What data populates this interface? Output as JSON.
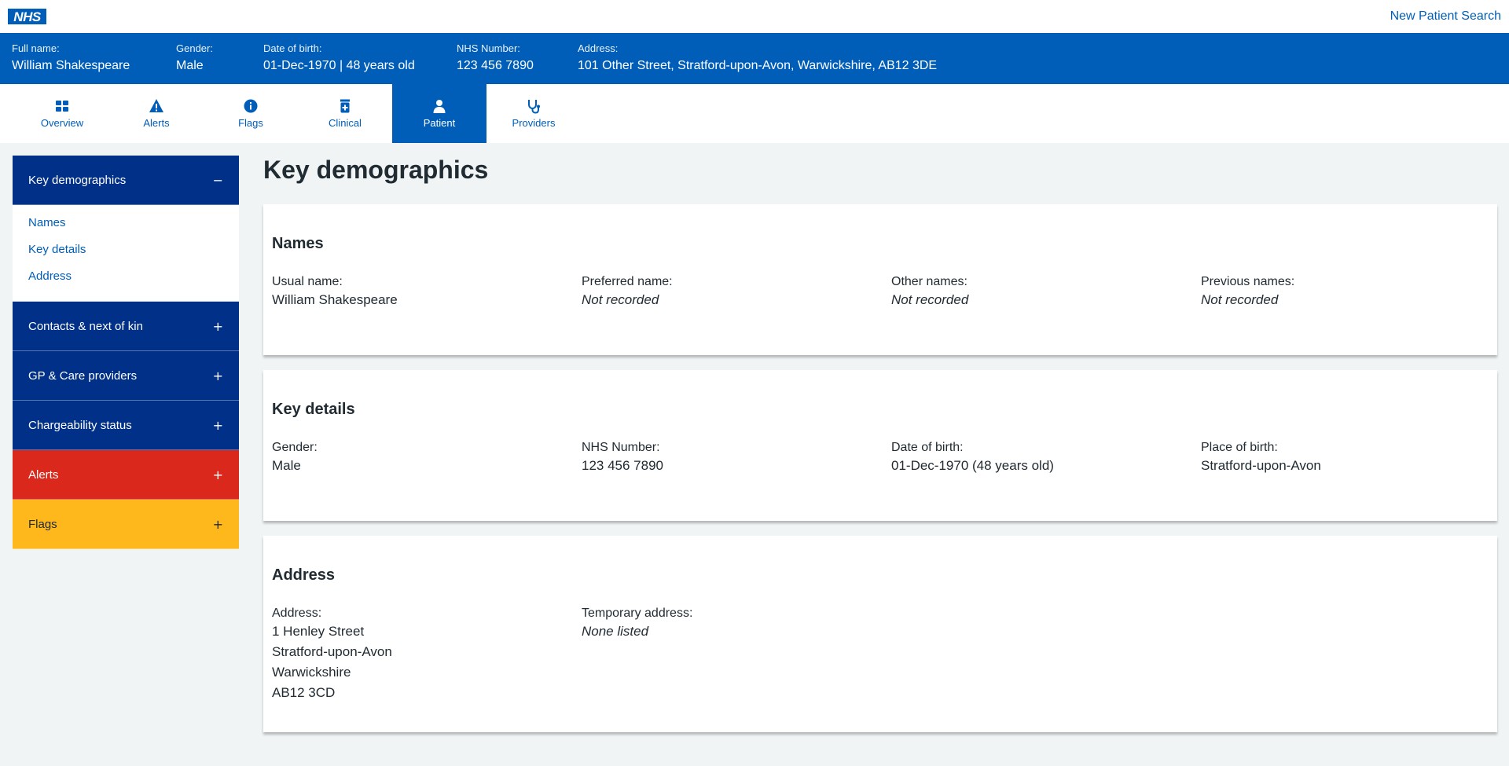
{
  "header": {
    "logo_text": "NHS",
    "new_search": "New Patient Search"
  },
  "banner": {
    "full_name": {
      "label": "Full name:",
      "value": "William Shakespeare"
    },
    "gender": {
      "label": "Gender:",
      "value": "Male"
    },
    "dob": {
      "label": "Date of birth:",
      "value": "01-Dec-1970 | 48 years old"
    },
    "nhs_number": {
      "label": "NHS Number:",
      "value": "123 456 7890"
    },
    "address": {
      "label": "Address:",
      "value": "101 Other Street, Stratford-upon-Avon, Warwickshire, AB12 3DE"
    }
  },
  "tabs": [
    {
      "label": "Overview",
      "icon": "grid-icon"
    },
    {
      "label": "Alerts",
      "icon": "warning-icon"
    },
    {
      "label": "Flags",
      "icon": "info-icon"
    },
    {
      "label": "Clinical",
      "icon": "medicine-icon"
    },
    {
      "label": "Patient",
      "icon": "person-icon",
      "active": true
    },
    {
      "label": "Providers",
      "icon": "stethoscope-icon"
    }
  ],
  "sidebar": {
    "key_demographics": {
      "label": "Key demographics",
      "sign": "−",
      "links": [
        "Names",
        "Key details",
        "Address"
      ]
    },
    "contacts": {
      "label": "Contacts & next of kin",
      "sign": "+"
    },
    "gp": {
      "label": "GP & Care providers",
      "sign": "+"
    },
    "chargeability": {
      "label": "Chargeability status",
      "sign": "+"
    },
    "alerts": {
      "label": "Alerts",
      "sign": "+"
    },
    "flags": {
      "label": "Flags",
      "sign": "+"
    }
  },
  "main": {
    "title": "Key demographics",
    "names": {
      "heading": "Names",
      "usual": {
        "label": "Usual name:",
        "value": "William Shakespeare"
      },
      "preferred": {
        "label": "Preferred name:",
        "value": "Not recorded"
      },
      "other": {
        "label": "Other names:",
        "value": "Not recorded"
      },
      "previous": {
        "label": "Previous names:",
        "value": "Not recorded"
      }
    },
    "key_details": {
      "heading": "Key details",
      "gender": {
        "label": "Gender:",
        "value": "Male"
      },
      "nhs_number": {
        "label": "NHS Number:",
        "value": "123 456 7890"
      },
      "dob": {
        "label": "Date of birth:",
        "value": "01-Dec-1970 (48 years old)"
      },
      "pob": {
        "label": "Place of birth:",
        "value": "Stratford-upon-Avon"
      }
    },
    "address": {
      "heading": "Address",
      "address": {
        "label": "Address:",
        "lines": [
          "1 Henley Street",
          "Stratford-upon-Avon",
          "Warwickshire",
          "AB12 3CD"
        ]
      },
      "temporary": {
        "label": "Temporary address:",
        "value": "None listed"
      }
    }
  },
  "colors": {
    "nhs_blue": "#005eb8",
    "dark_blue": "#003087",
    "red": "#da291c",
    "yellow": "#ffb81c",
    "background": "#f0f4f5"
  }
}
